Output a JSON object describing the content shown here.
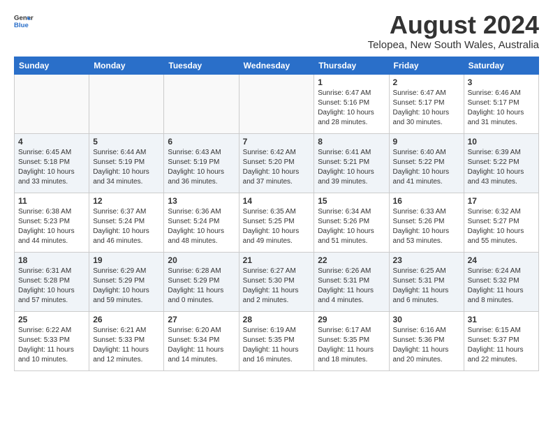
{
  "header": {
    "logo_general": "General",
    "logo_blue": "Blue",
    "month_year": "August 2024",
    "location": "Telopea, New South Wales, Australia"
  },
  "weekdays": [
    "Sunday",
    "Monday",
    "Tuesday",
    "Wednesday",
    "Thursday",
    "Friday",
    "Saturday"
  ],
  "weeks": [
    [
      {
        "day": "",
        "info": ""
      },
      {
        "day": "",
        "info": ""
      },
      {
        "day": "",
        "info": ""
      },
      {
        "day": "",
        "info": ""
      },
      {
        "day": "1",
        "info": "Sunrise: 6:47 AM\nSunset: 5:16 PM\nDaylight: 10 hours\nand 28 minutes."
      },
      {
        "day": "2",
        "info": "Sunrise: 6:47 AM\nSunset: 5:17 PM\nDaylight: 10 hours\nand 30 minutes."
      },
      {
        "day": "3",
        "info": "Sunrise: 6:46 AM\nSunset: 5:17 PM\nDaylight: 10 hours\nand 31 minutes."
      }
    ],
    [
      {
        "day": "4",
        "info": "Sunrise: 6:45 AM\nSunset: 5:18 PM\nDaylight: 10 hours\nand 33 minutes."
      },
      {
        "day": "5",
        "info": "Sunrise: 6:44 AM\nSunset: 5:19 PM\nDaylight: 10 hours\nand 34 minutes."
      },
      {
        "day": "6",
        "info": "Sunrise: 6:43 AM\nSunset: 5:19 PM\nDaylight: 10 hours\nand 36 minutes."
      },
      {
        "day": "7",
        "info": "Sunrise: 6:42 AM\nSunset: 5:20 PM\nDaylight: 10 hours\nand 37 minutes."
      },
      {
        "day": "8",
        "info": "Sunrise: 6:41 AM\nSunset: 5:21 PM\nDaylight: 10 hours\nand 39 minutes."
      },
      {
        "day": "9",
        "info": "Sunrise: 6:40 AM\nSunset: 5:22 PM\nDaylight: 10 hours\nand 41 minutes."
      },
      {
        "day": "10",
        "info": "Sunrise: 6:39 AM\nSunset: 5:22 PM\nDaylight: 10 hours\nand 43 minutes."
      }
    ],
    [
      {
        "day": "11",
        "info": "Sunrise: 6:38 AM\nSunset: 5:23 PM\nDaylight: 10 hours\nand 44 minutes."
      },
      {
        "day": "12",
        "info": "Sunrise: 6:37 AM\nSunset: 5:24 PM\nDaylight: 10 hours\nand 46 minutes."
      },
      {
        "day": "13",
        "info": "Sunrise: 6:36 AM\nSunset: 5:24 PM\nDaylight: 10 hours\nand 48 minutes."
      },
      {
        "day": "14",
        "info": "Sunrise: 6:35 AM\nSunset: 5:25 PM\nDaylight: 10 hours\nand 49 minutes."
      },
      {
        "day": "15",
        "info": "Sunrise: 6:34 AM\nSunset: 5:26 PM\nDaylight: 10 hours\nand 51 minutes."
      },
      {
        "day": "16",
        "info": "Sunrise: 6:33 AM\nSunset: 5:26 PM\nDaylight: 10 hours\nand 53 minutes."
      },
      {
        "day": "17",
        "info": "Sunrise: 6:32 AM\nSunset: 5:27 PM\nDaylight: 10 hours\nand 55 minutes."
      }
    ],
    [
      {
        "day": "18",
        "info": "Sunrise: 6:31 AM\nSunset: 5:28 PM\nDaylight: 10 hours\nand 57 minutes."
      },
      {
        "day": "19",
        "info": "Sunrise: 6:29 AM\nSunset: 5:29 PM\nDaylight: 10 hours\nand 59 minutes."
      },
      {
        "day": "20",
        "info": "Sunrise: 6:28 AM\nSunset: 5:29 PM\nDaylight: 11 hours\nand 0 minutes."
      },
      {
        "day": "21",
        "info": "Sunrise: 6:27 AM\nSunset: 5:30 PM\nDaylight: 11 hours\nand 2 minutes."
      },
      {
        "day": "22",
        "info": "Sunrise: 6:26 AM\nSunset: 5:31 PM\nDaylight: 11 hours\nand 4 minutes."
      },
      {
        "day": "23",
        "info": "Sunrise: 6:25 AM\nSunset: 5:31 PM\nDaylight: 11 hours\nand 6 minutes."
      },
      {
        "day": "24",
        "info": "Sunrise: 6:24 AM\nSunset: 5:32 PM\nDaylight: 11 hours\nand 8 minutes."
      }
    ],
    [
      {
        "day": "25",
        "info": "Sunrise: 6:22 AM\nSunset: 5:33 PM\nDaylight: 11 hours\nand 10 minutes."
      },
      {
        "day": "26",
        "info": "Sunrise: 6:21 AM\nSunset: 5:33 PM\nDaylight: 11 hours\nand 12 minutes."
      },
      {
        "day": "27",
        "info": "Sunrise: 6:20 AM\nSunset: 5:34 PM\nDaylight: 11 hours\nand 14 minutes."
      },
      {
        "day": "28",
        "info": "Sunrise: 6:19 AM\nSunset: 5:35 PM\nDaylight: 11 hours\nand 16 minutes."
      },
      {
        "day": "29",
        "info": "Sunrise: 6:17 AM\nSunset: 5:35 PM\nDaylight: 11 hours\nand 18 minutes."
      },
      {
        "day": "30",
        "info": "Sunrise: 6:16 AM\nSunset: 5:36 PM\nDaylight: 11 hours\nand 20 minutes."
      },
      {
        "day": "31",
        "info": "Sunrise: 6:15 AM\nSunset: 5:37 PM\nDaylight: 11 hours\nand 22 minutes."
      }
    ]
  ]
}
